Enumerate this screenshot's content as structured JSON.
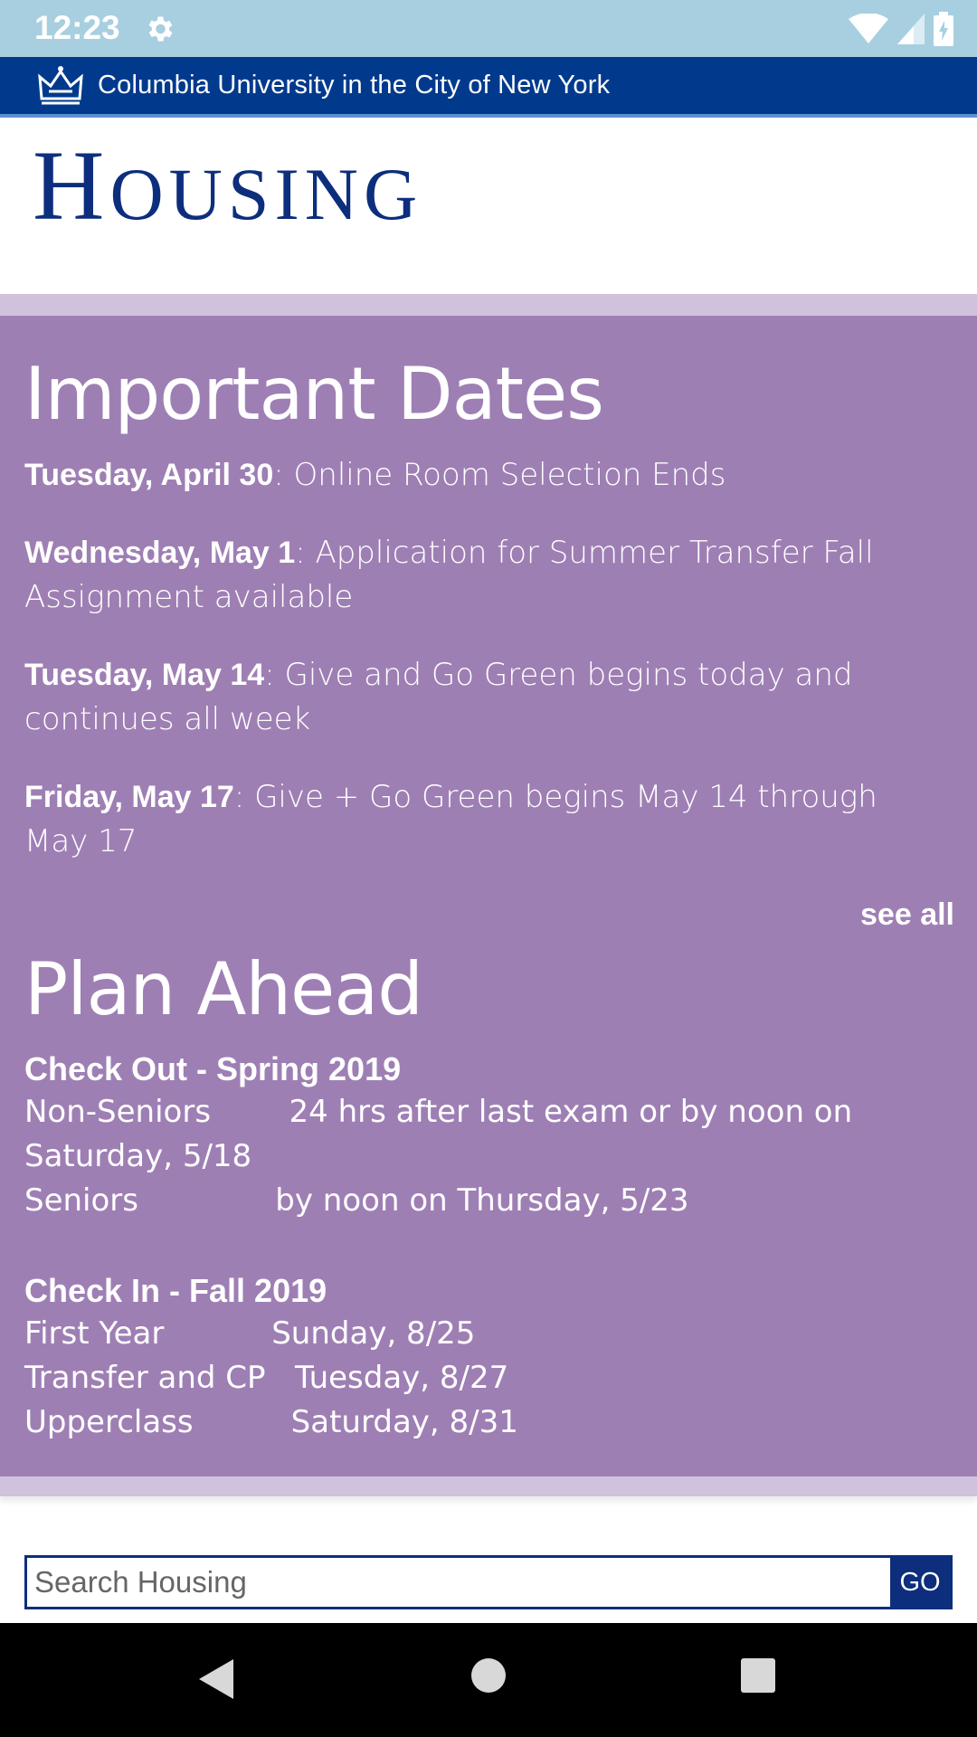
{
  "status_bar": {
    "time": "12:23",
    "icons": [
      "settings-icon",
      "wifi-icon",
      "signal-icon",
      "battery-icon"
    ]
  },
  "header": {
    "university": "Columbia University in the City of New York",
    "logo": "crown-icon"
  },
  "site_title": {
    "first_letter": "H",
    "rest": "OUSING"
  },
  "important_dates": {
    "title": "Important Dates",
    "entries": [
      {
        "date": "Tuesday, April 30",
        "text": ": Online Room Selection Ends"
      },
      {
        "date": "Wednesday, May 1",
        "text": ": Application for Summer Transfer Fall Assignment available"
      },
      {
        "date": "Tuesday, May 14",
        "text": ": Give and Go Green begins today and continues all week"
      },
      {
        "date": "Friday, May 17",
        "text": ": Give + Go Green begins May 14 through May 17"
      }
    ],
    "see_all": "see all"
  },
  "plan_ahead": {
    "title": "Plan Ahead",
    "checkout": {
      "heading": "Check Out - Spring 2019",
      "lines": [
        "Non-Seniors        24 hrs after last exam or by noon on",
        "Saturday, 5/18",
        "Seniors              by noon on Thursday, 5/23"
      ]
    },
    "checkin": {
      "heading": "Check In - Fall 2019",
      "lines": [
        "First Year           Sunday, 8/25",
        "Transfer and CP   Tuesday, 8/27",
        "Upperclass          Saturday, 8/31"
      ]
    }
  },
  "search": {
    "placeholder": "Search Housing",
    "button": "GO"
  },
  "nav": {
    "icons": [
      "back-icon",
      "home-icon",
      "recents-icon"
    ]
  },
  "colors": {
    "status_bar": "#a8cfe0",
    "header": "#013a8d",
    "title": "#0c2e7d",
    "purple": "#9e7fb4",
    "light_purple": "#d0c1dd"
  }
}
